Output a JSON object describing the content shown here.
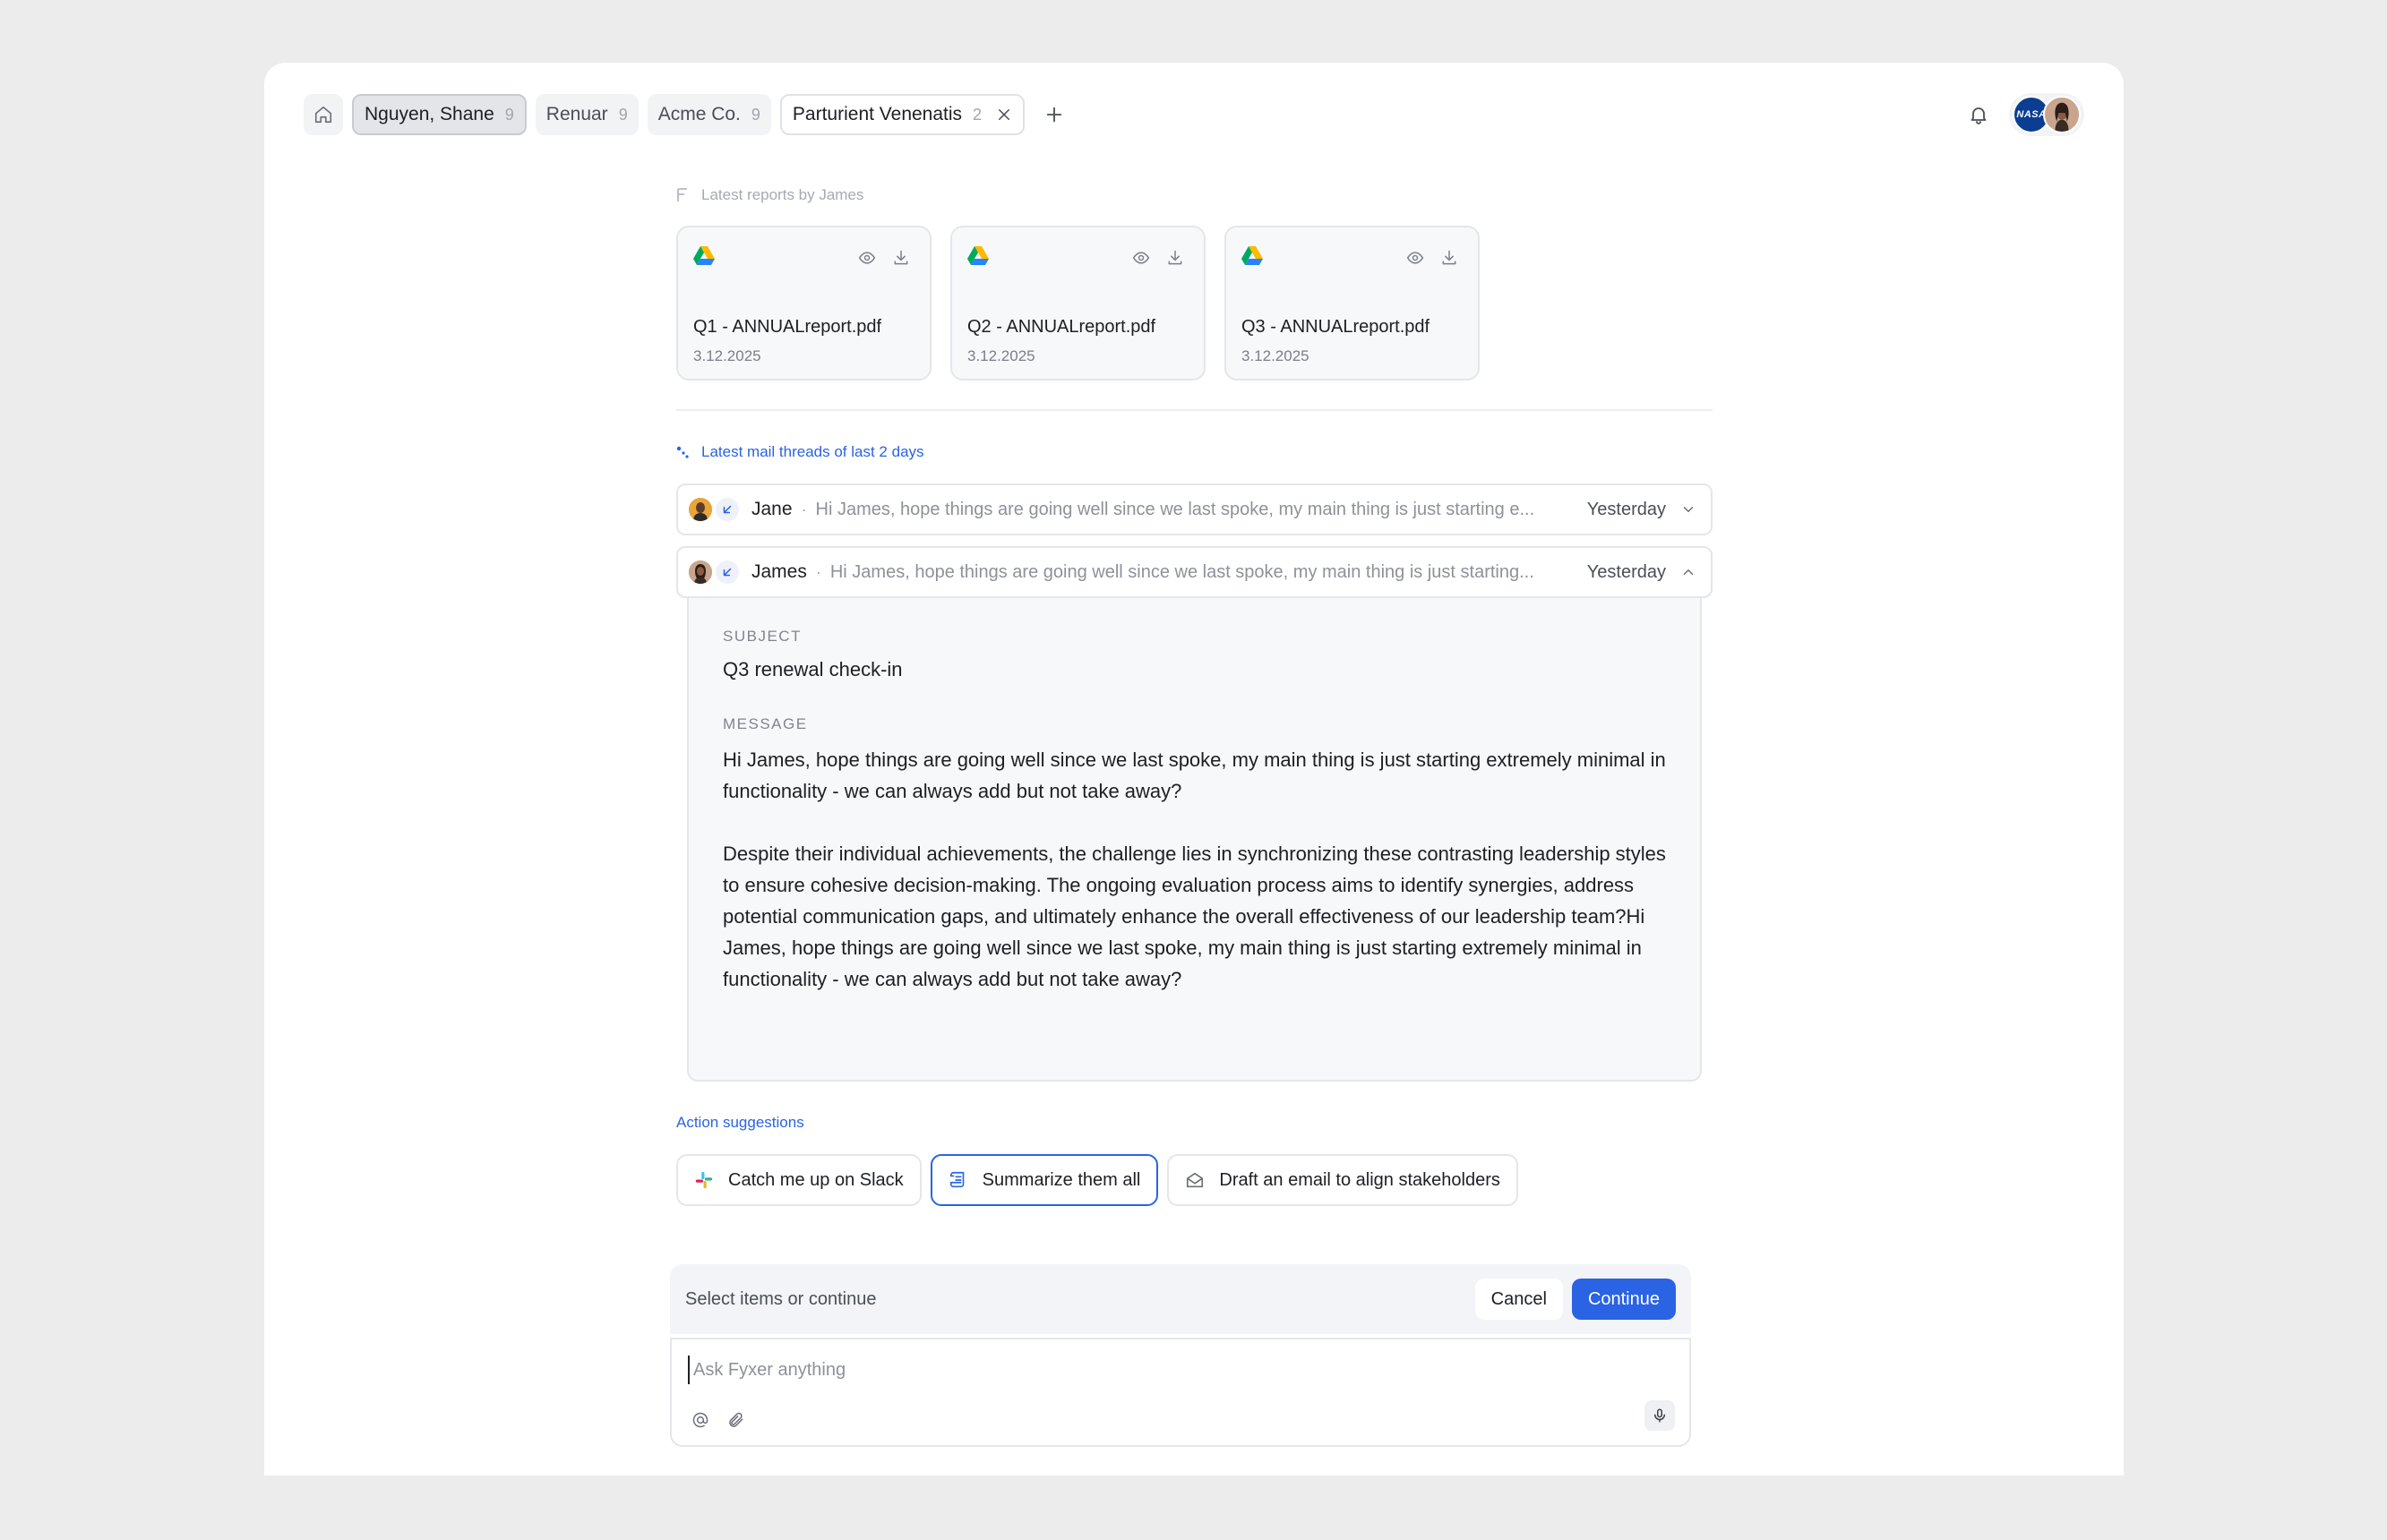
{
  "tabs": [
    {
      "label": "Nguyen, Shane",
      "count": "9"
    },
    {
      "label": "Renuar",
      "count": "9"
    },
    {
      "label": "Acme Co.",
      "count": "9"
    },
    {
      "label": "Parturient Venenatis",
      "count": "2"
    }
  ],
  "avatars": {
    "org_badge": "NASA"
  },
  "reports": {
    "label": "Latest reports by James",
    "files": [
      {
        "name": "Q1 - ANNUALreport.pdf",
        "date": "3.12.2025"
      },
      {
        "name": "Q2 - ANNUALreport.pdf",
        "date": "3.12.2025"
      },
      {
        "name": "Q3 - ANNUALreport.pdf",
        "date": "3.12.2025"
      }
    ]
  },
  "mail": {
    "label": "Latest mail threads of last 2 days",
    "threads": [
      {
        "sender": "Jane",
        "preview": "Hi James, hope things are going well since we last spoke, my main thing is just starting e...",
        "when": "Yesterday"
      },
      {
        "sender": "James",
        "preview": "Hi James, hope things are going well since we last spoke, my main thing is just starting...",
        "when": "Yesterday"
      }
    ],
    "expanded": {
      "subject_label": "SUBJECT",
      "subject": "Q3 renewal check-in",
      "message_label": "MESSAGE",
      "message": "Hi James, hope things are going well since we last spoke, my main thing is just starting extremely minimal in functionality - we can always add but not take away?\n\nDespite their individual achievements, the challenge lies in synchronizing these contrasting leadership styles to ensure cohesive decision-making. The ongoing evaluation process aims to identify synergies, address potential communication gaps, and ultimately enhance the overall effectiveness of our leadership team?Hi James, hope things are going well since we last spoke, my main thing is just starting extremely minimal in functionality - we can always add but not take away?"
    }
  },
  "actions": {
    "label": "Action suggestions",
    "items": [
      {
        "label": "Catch me up on Slack",
        "icon": "slack-icon"
      },
      {
        "label": "Summarize them all",
        "icon": "scroll-icon"
      },
      {
        "label": "Draft an email to align stakeholders",
        "icon": "envelope-open-icon"
      }
    ]
  },
  "composer": {
    "hint": "Select items or continue",
    "cancel": "Cancel",
    "continue": "Continue",
    "placeholder": "Ask Fyxer anything"
  },
  "colors": {
    "accent": "#2a63e4",
    "background": "#ececec"
  }
}
